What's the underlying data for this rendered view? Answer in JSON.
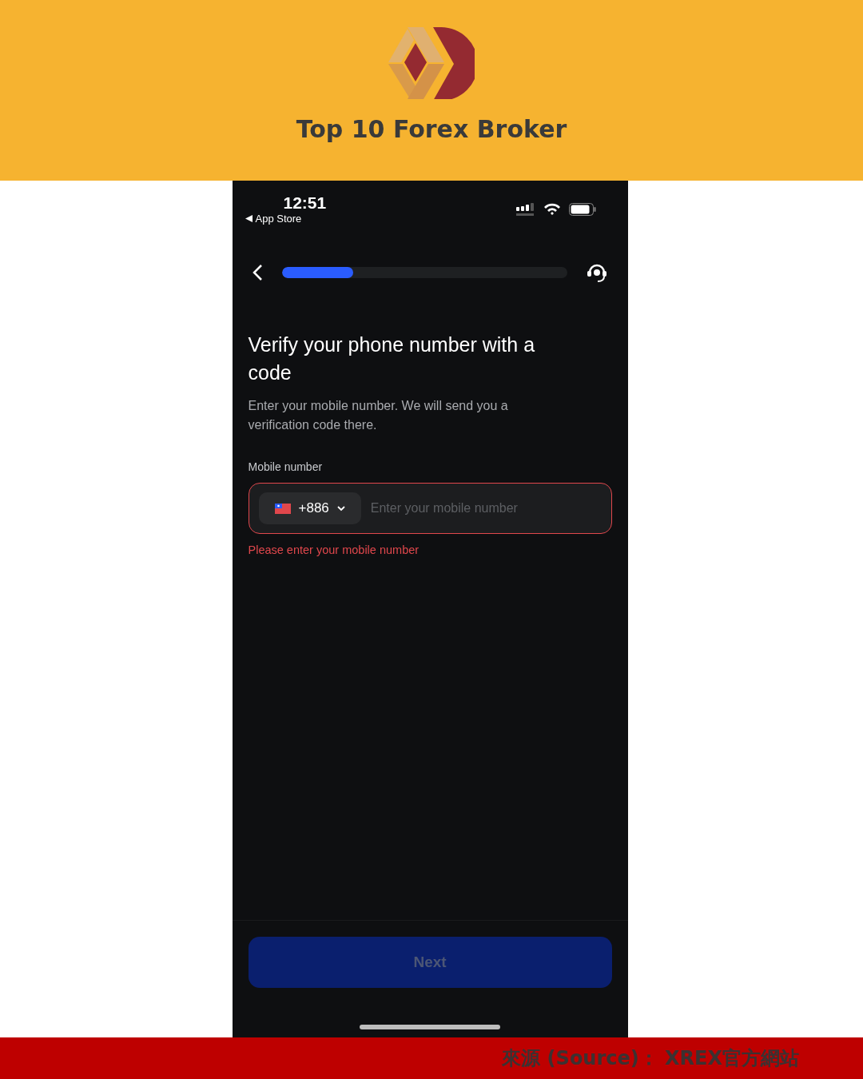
{
  "banner": {
    "title": "Top 10 Forex Broker"
  },
  "status_bar": {
    "time": "12:51",
    "back_label": "App Store"
  },
  "nav": {
    "progress": {
      "level": 0.25
    }
  },
  "heading": "Verify your phone number with a code",
  "description": "Enter your mobile number. We will send you a verification code there.",
  "phone_field": {
    "label": "Mobile number",
    "country_code": "+886",
    "placeholder": "Enter your mobile number",
    "error": "Please enter your mobile number"
  },
  "next_button": {
    "label": "Next",
    "disabled": true
  },
  "footer": {
    "source": "來源 (Source)： XREX官方網站"
  }
}
